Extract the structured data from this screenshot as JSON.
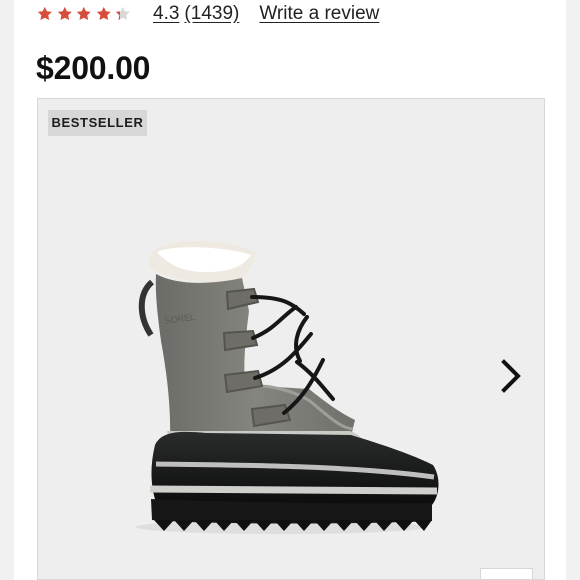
{
  "rating": {
    "value": "4.3",
    "count": "(1439)",
    "review_link": "Write a review",
    "stars_value": 4.3,
    "max_stars": 5,
    "star_color": "#d64e3b",
    "empty_star_color": "#d8d8d8"
  },
  "price": {
    "amount": "$200.00"
  },
  "product_card": {
    "badge": "BESTSELLER",
    "image_icon": "winter-boot-image",
    "next_icon": "chevron-right-icon"
  },
  "colors": {
    "card_background": "#eeeeee",
    "badge_background": "#d7d7d7",
    "text": "#111111",
    "accent": "#d64e3b"
  }
}
